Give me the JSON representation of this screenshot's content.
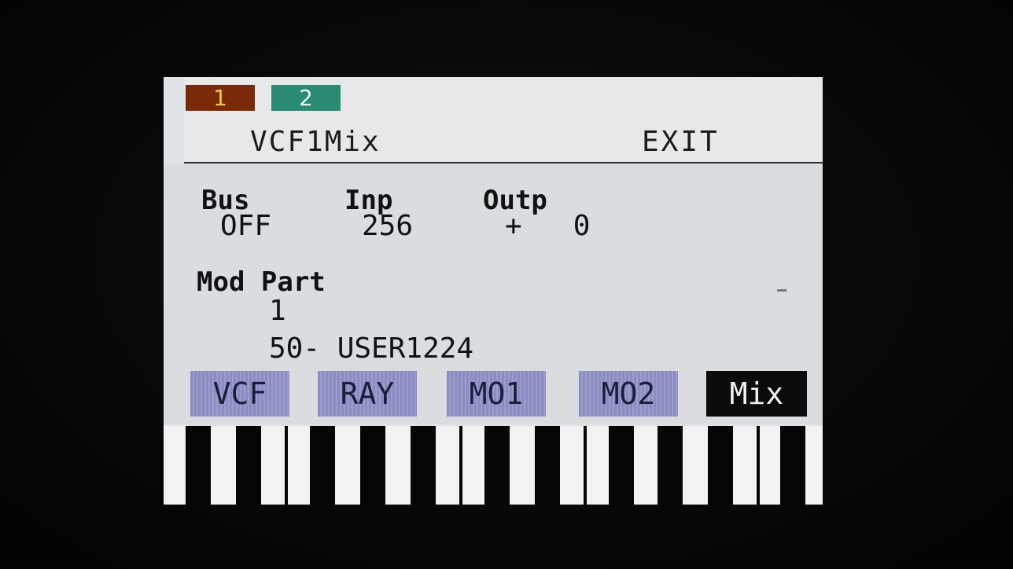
{
  "tabs": [
    {
      "label": "1",
      "active": false
    },
    {
      "label": "2",
      "active": true
    }
  ],
  "header": {
    "title": "VCF1Mix",
    "exit_label": "EXIT"
  },
  "params": {
    "bus": {
      "label": "Bus",
      "value": "OFF"
    },
    "inp": {
      "label": "Inp",
      "value": "256"
    },
    "outp": {
      "label": "Outp",
      "value": "+   0"
    },
    "mod_part": {
      "label": "Mod Part",
      "value": "1"
    },
    "preset": "50- USER1224"
  },
  "buttons": [
    {
      "label": "VCF",
      "active": false
    },
    {
      "label": "RAY",
      "active": false
    },
    {
      "label": "MO1",
      "active": false
    },
    {
      "label": "MO2",
      "active": false
    },
    {
      "label": "Mix",
      "active": true
    }
  ],
  "colors": {
    "tab1_bg": "#7a2a08",
    "tab2_bg": "#2a8a72",
    "button_bg": "#8b8dc0",
    "button_active_bg": "#0c0c0c",
    "screen_bg": "#dfe3e6"
  }
}
